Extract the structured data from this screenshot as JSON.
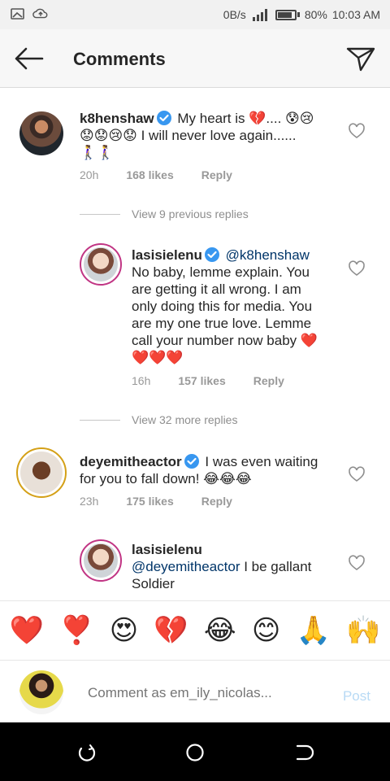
{
  "status_bar": {
    "data_rate": "0B/s",
    "battery": "80%",
    "time": "10:03 AM"
  },
  "header": {
    "title": "Comments"
  },
  "comments": [
    {
      "username": "k8henshaw",
      "text_parts": [
        "My heart is 💔.... 😰😢",
        "😟😟😢😟 I will never love again......",
        "🚶‍♀️🚶‍♀️"
      ],
      "time": "20h",
      "likes": "168 likes",
      "reply": "Reply"
    },
    {
      "view_replies": "View 9 previous replies"
    },
    {
      "username": "lasisielenu",
      "mention": "@k8henshaw",
      "lines": [
        "No baby, lemme explain. You",
        "are getting it all wrong. I am",
        "only doing this for media. You",
        "are my one true love. Lemme",
        "call your number now baby ❤️",
        "❤️❤️❤️"
      ],
      "time": "16h",
      "likes": "157 likes",
      "reply": "Reply"
    },
    {
      "view_replies": "View 32 more replies"
    },
    {
      "username": "deyemitheactor",
      "text_line1": "I was even waiting",
      "text_line2": "for you to fall down! 😂😂😂",
      "time": "23h",
      "likes": "175 likes",
      "reply": "Reply"
    },
    {
      "username": "lasisielenu",
      "mention": "@deyemitheactor",
      "text_line1": " I be gallant",
      "text_line2": "Soldier"
    }
  ],
  "emoji_bar": [
    "❤️",
    "❣️",
    "😍",
    "💔",
    "😂",
    "😊",
    "🙏",
    "🙌"
  ],
  "composer": {
    "placeholder": "Comment as em_ily_nicolas...",
    "post_label": "Post"
  },
  "colors": {
    "verified": "#3897f0",
    "story_ring": "#c13584",
    "post_disabled": "#b8daf5"
  }
}
